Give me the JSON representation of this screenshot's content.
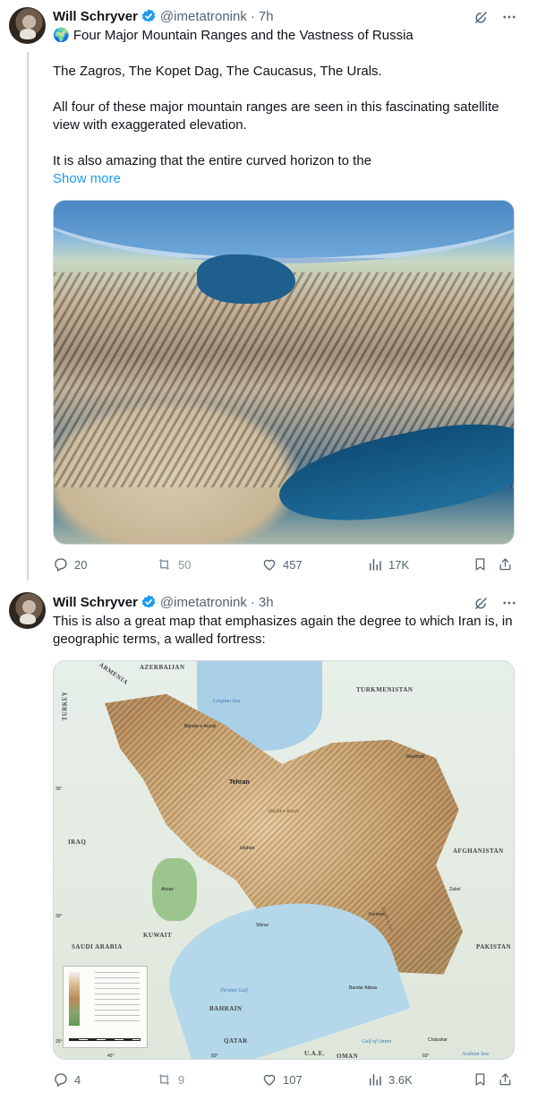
{
  "tweets": [
    {
      "author_name": "Will Schryver",
      "handle": "@imetatronink",
      "separator": "·",
      "time": "7h",
      "text_lines": [
        "🌍 Four Major Mountain Ranges and the Vastness of Russia",
        "The Zagros, The Kopet Dag, The Caucasus, The Urals.",
        "All four of these major mountain ranges are seen in this fascinating satellite view with exaggerated elevation.",
        "It is also amazing that the entire curved horizon to the"
      ],
      "show_more": "Show more",
      "stats": {
        "replies": "20",
        "retweets": "50",
        "likes": "457",
        "views": "17K"
      }
    },
    {
      "author_name": "Will Schryver",
      "handle": "@imetatronink",
      "separator": "·",
      "time": "3h",
      "text_lines": [
        "This is also a great map that emphasizes again the degree to which Iran is, in geographic terms, a walled fortress:"
      ],
      "map": {
        "countries": [
          "ARMENIA",
          "AZERBAIJAN",
          "TURKMENISTAN",
          "TURKEY",
          "IRAQ",
          "AFGHANISTAN",
          "KUWAIT",
          "SAUDI ARABIA",
          "PAKISTAN",
          "BAHRAIN",
          "QATAR",
          "U.A.E.",
          "OMAN"
        ],
        "waters": [
          "Caspian Sea",
          "Persian Gulf",
          "Gulf of Oman",
          "Arabian Sea"
        ],
        "cities": [
          "Tehran",
          "Mashhad",
          "Isfahan",
          "Shiraz",
          "Bandar-e Anzali",
          "Zabol",
          "Chabahar",
          "Bandar Abbas",
          "Ahvaz",
          "Kerman"
        ],
        "regions": [
          "Dasht-e Kavir",
          "Dasht-e Lut"
        ],
        "latitudes": [
          "35°",
          "30°",
          "25°"
        ],
        "longitudes": [
          "45°",
          "50°",
          "60°"
        ]
      },
      "stats": {
        "replies": "4",
        "retweets": "9",
        "likes": "107",
        "views": "3.6K"
      }
    }
  ],
  "icons": {
    "verified": "verified-badge-icon",
    "grok": "grok-icon",
    "more": "more-icon",
    "reply": "reply-icon",
    "retweet": "retweet-icon",
    "like": "like-icon",
    "views": "views-icon",
    "bookmark": "bookmark-icon",
    "share": "share-icon"
  },
  "colors": {
    "accent": "#1d9bf0",
    "text": "#0f1419",
    "muted": "#536471",
    "border": "#cfd9de"
  }
}
